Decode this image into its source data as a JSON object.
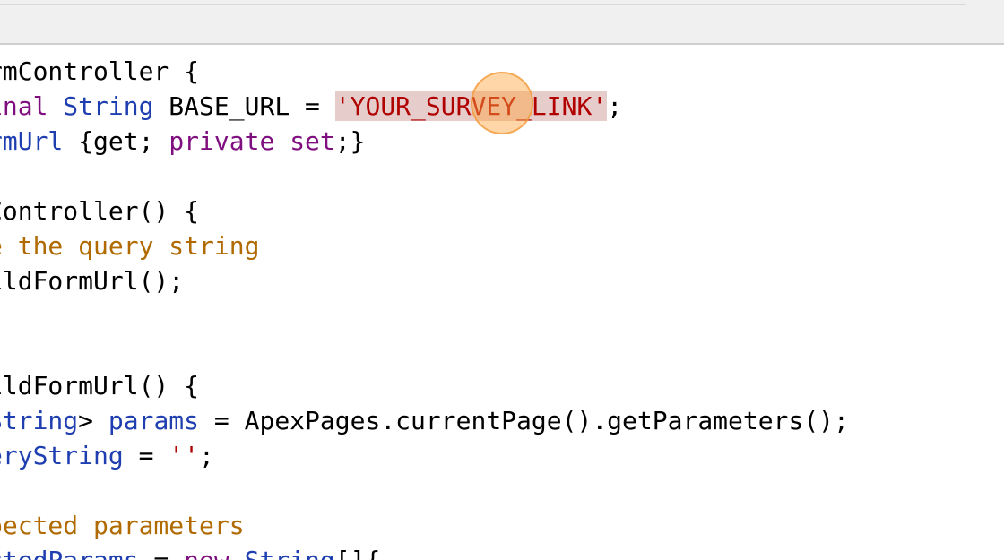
{
  "colors": {
    "keyword": "#7f0f7f",
    "type": "#1f3fb0",
    "string": "#b00000",
    "comment": "#b06a00",
    "selection": "#e7cccc",
    "cursor_highlight": "#ffa53c"
  },
  "code": {
    "line1": {
      "a": "rmController {"
    },
    "line2": {
      "kw": "inal",
      "sp1": " ",
      "type": "String",
      "rest": " BASE_URL = ",
      "str": "'YOUR_SURVEY_LINK'",
      "end": ";"
    },
    "line3": {
      "ident": "rmUrl",
      "rest": " {get; ",
      "kw": "private",
      "sp": " ",
      "kw2": "set",
      "end": ";}"
    },
    "line4": {
      "a": ""
    },
    "line5": {
      "a": "Controller() {"
    },
    "line6": {
      "cmt": "e the query string"
    },
    "line7": {
      "a": "ildFormUrl();"
    },
    "line8": {
      "a": ""
    },
    "line9": {
      "a": ""
    },
    "line10": {
      "a": "ildFormUrl() {"
    },
    "line11": {
      "type": "String",
      "rest": "> ",
      "ident": "params",
      "rest2": " = ApexPages.currentPage().getParameters();"
    },
    "line12": {
      "ident": "eryString",
      "rest": " = ",
      "str": "''",
      "end": ";"
    },
    "line13": {
      "a": ""
    },
    "line14": {
      "cmt": "pected parameters"
    },
    "line15": {
      "ident": "ctedParams",
      "rest": " = ",
      "kw": "new",
      "sp": " ",
      "type": "String",
      "end": "[]{"
    }
  }
}
